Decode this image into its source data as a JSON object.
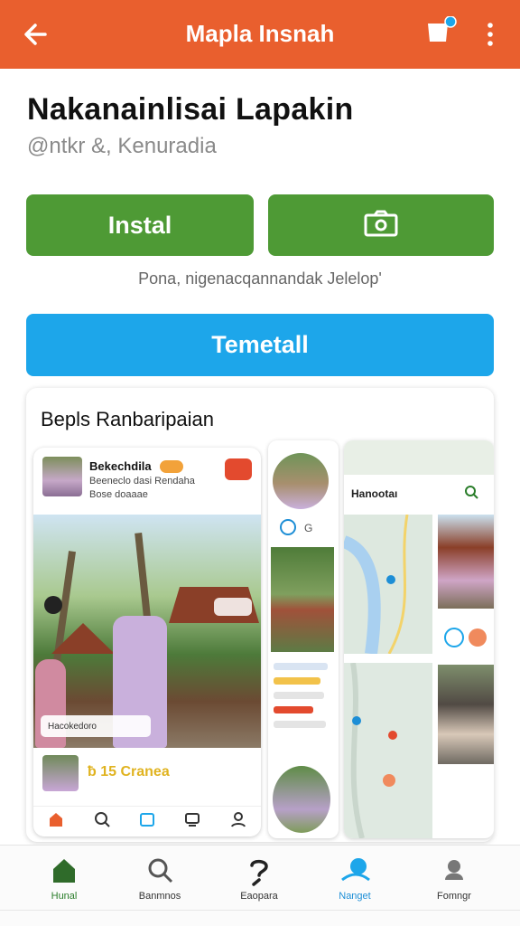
{
  "topbar": {
    "title": "Mapla Insnah",
    "cart_badge_color": "#1da6ea"
  },
  "app": {
    "name": "Nakanainlisai Lapakin",
    "subtitle": "@ntkr &, Kenuradia"
  },
  "actions": {
    "install_label": "Instal",
    "note": "Pona, nigenacqannandak Jelelop'",
    "blue_label": "Temetall"
  },
  "gallery": {
    "title": "Bepls Ranbaripaian",
    "shot1": {
      "name": "Bekechdila",
      "line1": "Beeneclo dasi Rendaha",
      "line2": "Bose doaaae",
      "tag": "Hacokedoro",
      "price": "ƀ 15 Cranea"
    },
    "shot3": {
      "label": "Hanootaı"
    }
  },
  "colors": {
    "brand": "#e95f2e",
    "green": "#4e9a35",
    "blue": "#1da6ea"
  },
  "bottom_nav": [
    {
      "label": "Hunal",
      "icon": "home-icon"
    },
    {
      "label": "Banmnos",
      "icon": "search-icon"
    },
    {
      "label": "Eaopara",
      "icon": "question-icon"
    },
    {
      "label": "Nanget",
      "icon": "map-pin-icon"
    },
    {
      "label": "Fomngr",
      "icon": "profile-icon"
    }
  ]
}
